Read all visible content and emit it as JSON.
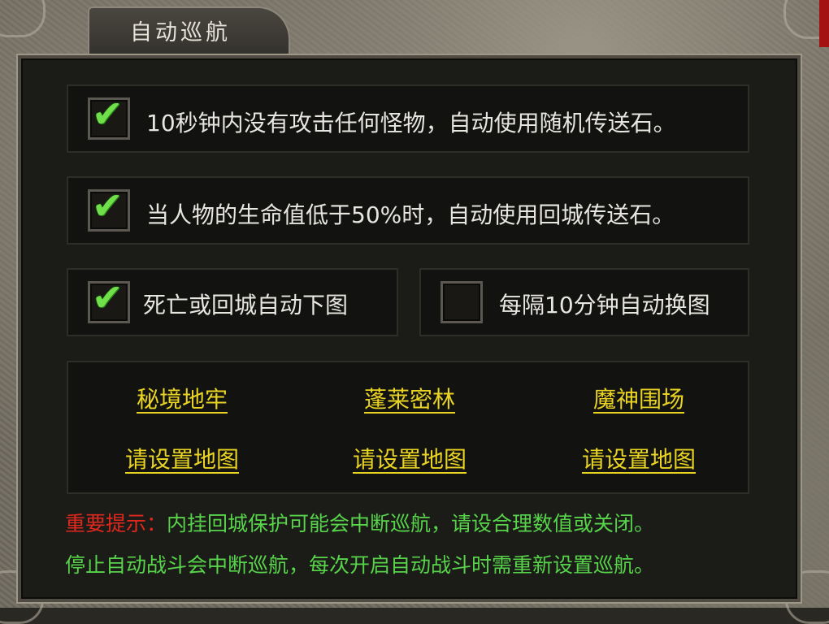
{
  "window": {
    "title": "自动巡航"
  },
  "options": [
    {
      "label": "10秒钟内没有攻击任何怪物，自动使用随机传送石。",
      "checked": true,
      "check_glyph": "✔"
    },
    {
      "label": "当人物的生命值低于50%时，自动使用回城传送石。",
      "checked": true,
      "check_glyph": "✔"
    },
    {
      "label": "死亡或回城自动下图",
      "checked": true,
      "check_glyph": "✔"
    },
    {
      "label": "每隔10分钟自动换图",
      "checked": false,
      "check_glyph": ""
    }
  ],
  "maps": {
    "names": [
      "秘境地牢",
      "蓬莱密林",
      "魔神围场"
    ],
    "settings": [
      "请设置地图",
      "请设置地图",
      "请设置地图"
    ]
  },
  "tips": {
    "prefix": "重要提示：",
    "line1": "内挂回城保护可能会中断巡航，请设合理数值或关闭。",
    "line2": "停止自动战斗会中断巡航，每次开启自动战斗时需重新设置巡航。"
  },
  "colors": {
    "map_link": "#e9d424",
    "check": "#6fe04a",
    "tip_warning": "#e0281e",
    "tip_text": "#57d44a"
  }
}
